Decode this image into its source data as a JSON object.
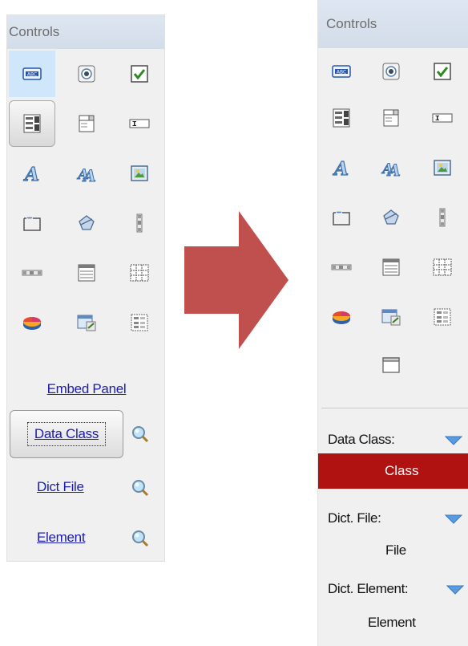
{
  "left_panel": {
    "title": "Controls",
    "links": {
      "embed_panel": "Embed Panel",
      "data_class": "Data Class",
      "dict_file": "Dict File",
      "element": "Element"
    }
  },
  "right_panel": {
    "title": "Controls",
    "properties": [
      {
        "label": "Data Class:",
        "value": "Class",
        "highlighted": true
      },
      {
        "label": "Dict. File:",
        "value": "File",
        "highlighted": false
      },
      {
        "label": "Dict. Element:",
        "value": "Element",
        "highlighted": false
      }
    ]
  },
  "icons": [
    "label-abc-icon",
    "radio-button-icon",
    "checkbox-icon",
    "listbox-spinner-icon",
    "combobox-icon",
    "textbox-icon",
    "label-a-icon",
    "font-a-icon",
    "picture-icon",
    "group-box-icon",
    "shape-icon",
    "vertical-scroll-icon",
    "horizontal-scroll-icon",
    "list-view-icon",
    "grid-icon",
    "pie-chart-icon",
    "web-control-icon",
    "form-grid-icon"
  ],
  "colors": {
    "accent_red": "#b01212",
    "arrow_red": "#c0504d",
    "link_blue": "#1c1cb0",
    "panel_bg": "#f0f0f0",
    "title_bg": "#d8e2ee",
    "selected_blue": "#cfe6fb"
  }
}
